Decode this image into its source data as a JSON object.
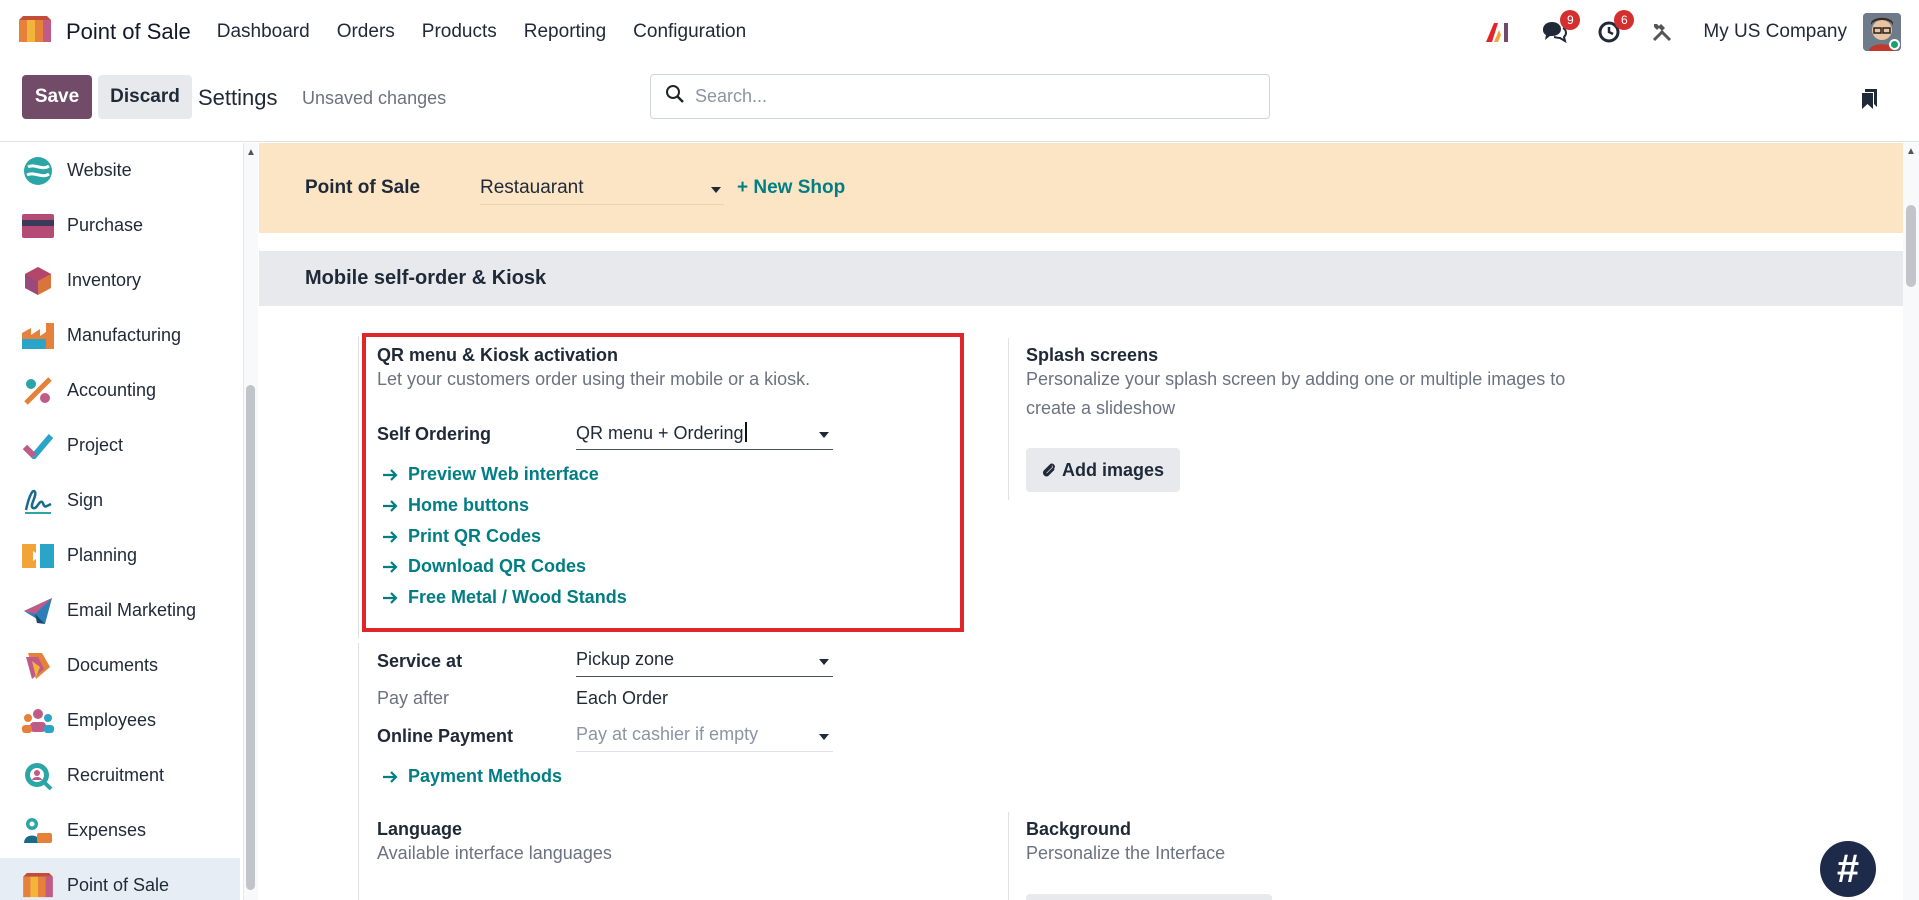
{
  "app": {
    "title": "Point of Sale",
    "menu": [
      "Dashboard",
      "Orders",
      "Products",
      "Reporting",
      "Configuration"
    ]
  },
  "topbar": {
    "messages_count": "9",
    "activities_count": "6",
    "company": "My US Company"
  },
  "control_panel": {
    "save_label": "Save",
    "discard_label": "Discard",
    "title": "Settings",
    "status": "Unsaved changes",
    "search_placeholder": "Search..."
  },
  "sidebar": {
    "items": [
      {
        "label": "Website",
        "icon": "website-icon",
        "color": "#2ba5a5"
      },
      {
        "label": "Purchase",
        "icon": "purchase-icon",
        "color": "#b54b75"
      },
      {
        "label": "Inventory",
        "icon": "inventory-icon",
        "color": "#d9743a"
      },
      {
        "label": "Manufacturing",
        "icon": "manufacturing-icon",
        "color": "#e5813a"
      },
      {
        "label": "Accounting",
        "icon": "accounting-icon",
        "color": "#e5813a"
      },
      {
        "label": "Project",
        "icon": "project-icon",
        "color": "#2ba5c7"
      },
      {
        "label": "Sign",
        "icon": "sign-icon",
        "color": "#1a6b8a"
      },
      {
        "label": "Planning",
        "icon": "planning-icon",
        "color": "#f2a33a"
      },
      {
        "label": "Email Marketing",
        "icon": "email-marketing-icon",
        "color": "#2e7fb8"
      },
      {
        "label": "Documents",
        "icon": "documents-icon",
        "color": "#e5813a"
      },
      {
        "label": "Employees",
        "icon": "employees-icon",
        "color": "#c05a86"
      },
      {
        "label": "Recruitment",
        "icon": "recruitment-icon",
        "color": "#2ba5a5"
      },
      {
        "label": "Expenses",
        "icon": "expenses-icon",
        "color": "#2ba5a5"
      },
      {
        "label": "Point of Sale",
        "icon": "point-of-sale-icon",
        "color": "#e5813a",
        "active": true
      }
    ]
  },
  "shop_bar": {
    "label": "Point of Sale",
    "selected_shop": "Restauarant",
    "new_shop_label": "+ New Shop"
  },
  "section": {
    "title": "Mobile self-order & Kiosk"
  },
  "qr_setting": {
    "title": "QR menu & Kiosk activation",
    "description": "Let your customers order using their mobile or a kiosk.",
    "self_ordering_label": "Self Ordering",
    "self_ordering_value": "QR menu + Ordering",
    "links": [
      "Preview Web interface",
      "Home buttons",
      "Print QR Codes",
      "Download QR Codes",
      "Free Metal / Wood Stands"
    ],
    "service_at_label": "Service at",
    "service_at_value": "Pickup zone",
    "pay_after_label": "Pay after",
    "pay_after_value": "Each Order",
    "online_payment_label": "Online Payment",
    "online_payment_placeholder": "Pay at cashier if empty",
    "payment_methods_link": "Payment Methods"
  },
  "splash_setting": {
    "title": "Splash screens",
    "description": "Personalize your splash screen by adding one or multiple images to create a slideshow",
    "add_images_label": "Add images"
  },
  "language_setting": {
    "title": "Language",
    "description": "Available interface languages"
  },
  "background_setting": {
    "title": "Background",
    "description": "Personalize the Interface"
  },
  "colors": {
    "brand": "#714b67",
    "link": "#017e84",
    "highlight": "#e0262b",
    "shop_bar": "#fbe5c5"
  }
}
